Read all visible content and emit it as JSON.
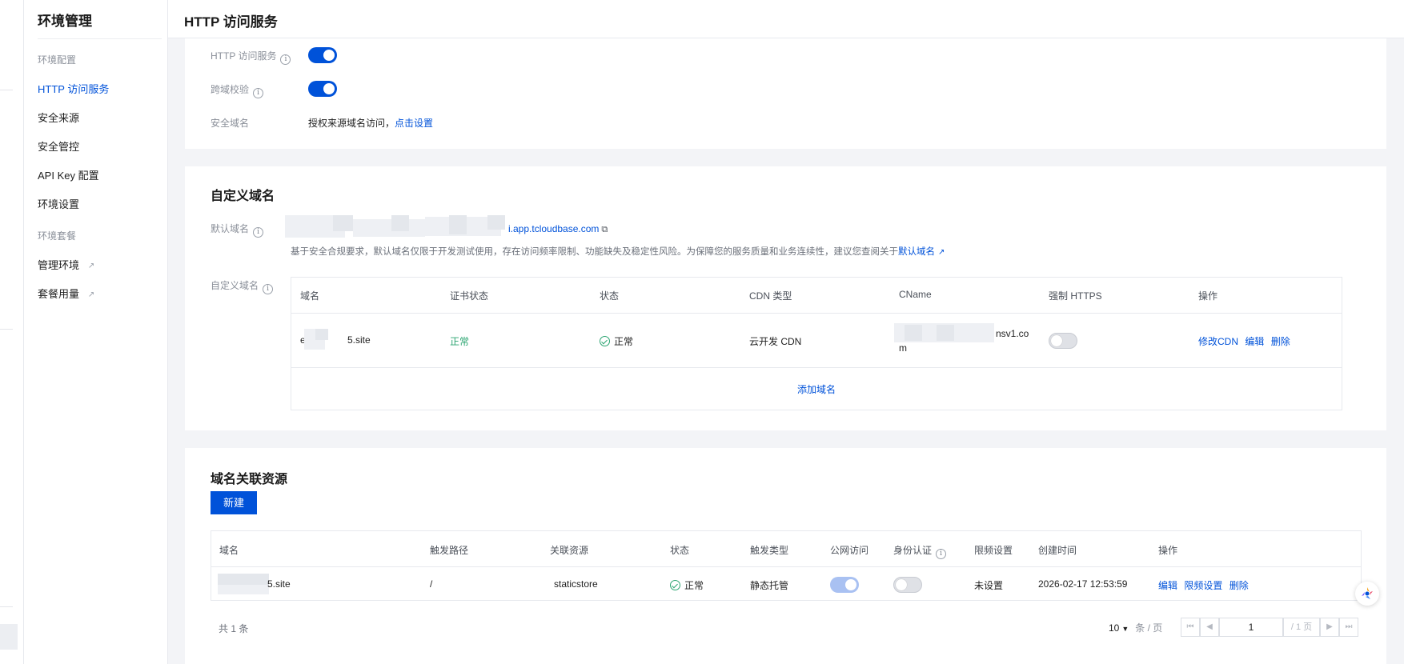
{
  "sidebar": {
    "title": "环境管理",
    "group_config": "环境配置",
    "items": [
      {
        "label": "HTTP 访问服务",
        "active": true
      },
      {
        "label": "安全来源"
      },
      {
        "label": "安全管控"
      },
      {
        "label": "API Key 配置"
      },
      {
        "label": "环境设置"
      }
    ],
    "group_plan": "环境套餐",
    "plan_items": [
      {
        "label": "管理环境",
        "icon": "external-link-icon"
      },
      {
        "label": "套餐用量",
        "icon": "external-link-icon"
      }
    ]
  },
  "header": {
    "title": "HTTP 访问服务"
  },
  "settings": {
    "http_service_label": "HTTP 访问服务",
    "http_service_on": true,
    "cors_label": "跨域校验",
    "cors_on": true,
    "safe_domain_label": "安全域名",
    "safe_domain_text": "授权来源域名访问，",
    "safe_domain_link": "点击设置"
  },
  "custom_domain": {
    "title": "自定义域名",
    "default_label": "默认域名",
    "default_value": "i.app.tcloudbase.com",
    "notice_text": "基于安全合规要求，默认域名仅限于开发测试使用，存在访问频率限制、功能缺失及稳定性风险。为保障您的服务质量和业务连续性，建议您查阅关于",
    "notice_link": "默认域名",
    "custom_label": "自定义域名",
    "columns": [
      "域名",
      "证书状态",
      "状态",
      "CDN 类型",
      "CName",
      "强制 HTTPS",
      "操作"
    ],
    "rows": [
      {
        "domain_prefix": "e",
        "domain_suffix": "5.site",
        "cert_status": "正常",
        "status": "正常",
        "cdn_type": "云开发 CDN",
        "cname_suffix": "nsv1.co",
        "cname_tail": "m",
        "force_https": false,
        "actions": [
          "修改CDN",
          "编辑",
          "删除"
        ]
      }
    ],
    "add_link": "添加域名"
  },
  "resources": {
    "title": "域名关联资源",
    "new_button": "新建",
    "columns": [
      "域名",
      "触发路径",
      "关联资源",
      "状态",
      "触发类型",
      "公网访问",
      "身份认证",
      "限频设置",
      "创建时间",
      "操作"
    ],
    "rows": [
      {
        "domain_suffix": "5.site",
        "path": "/",
        "resource": "staticstore",
        "status": "正常",
        "trigger_type": "静态托管",
        "public_access": true,
        "auth": false,
        "rate_limit": "未设置",
        "created": "2026-02-17 12:53:59",
        "actions": [
          "编辑",
          "限频设置",
          "删除"
        ]
      }
    ],
    "total": "共 1 条",
    "page_size": "10",
    "page_size_unit": "条 / 页",
    "page_input": "1",
    "page_total": "/ 1 页"
  },
  "colors": {
    "primary": "#0052d9",
    "success": "#2ba471",
    "muted": "#8a8f99"
  }
}
